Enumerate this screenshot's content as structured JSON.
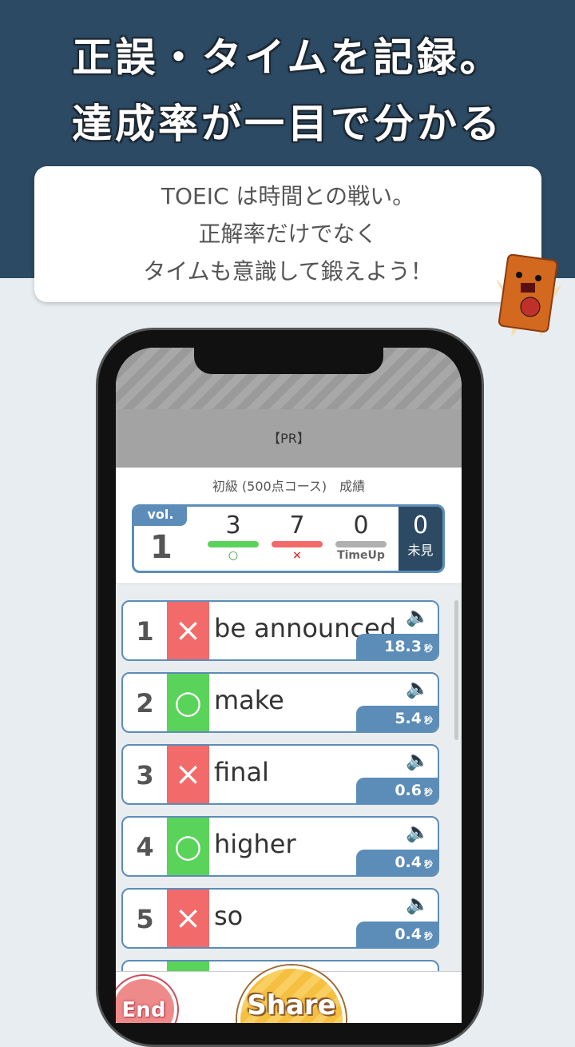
{
  "headline": {
    "line1": "正誤・タイムを記録。",
    "line2": "達成率が一目で分かる"
  },
  "callout": {
    "line1": "TOEIC は時間との戦い。",
    "line2": "正解率だけでなく",
    "line3": "タイムも意識して鍛えよう！"
  },
  "mascot": {
    "label": "雷門"
  },
  "app": {
    "ad_label": "【PR】",
    "course_title": "初級 (500点コース)　成績",
    "score": {
      "vol_label": "vol.",
      "vol": "1",
      "correct": "3",
      "correct_mark": "○",
      "wrong": "7",
      "wrong_mark": "×",
      "timeup": "0",
      "timeup_label": "TimeUp",
      "unseen": "0",
      "unseen_label": "未見"
    },
    "items": [
      {
        "num": "1",
        "result": "×",
        "word": "be announced",
        "time": "18.3",
        "unit": "秒"
      },
      {
        "num": "2",
        "result": "○",
        "word": "make",
        "time": "5.4",
        "unit": "秒"
      },
      {
        "num": "3",
        "result": "×",
        "word": "final",
        "time": "0.6",
        "unit": "秒"
      },
      {
        "num": "4",
        "result": "○",
        "word": "higher",
        "time": "0.4",
        "unit": "秒"
      },
      {
        "num": "5",
        "result": "×",
        "word": "so",
        "time": "0.4",
        "unit": "秒"
      }
    ],
    "end_label": "End",
    "share_label": "Share"
  },
  "colors": {
    "navy": "#2c4a63",
    "blue": "#5b8db8",
    "correct": "#5ad35a",
    "wrong": "#f26a6a",
    "timeup": "#b0b0b0"
  }
}
